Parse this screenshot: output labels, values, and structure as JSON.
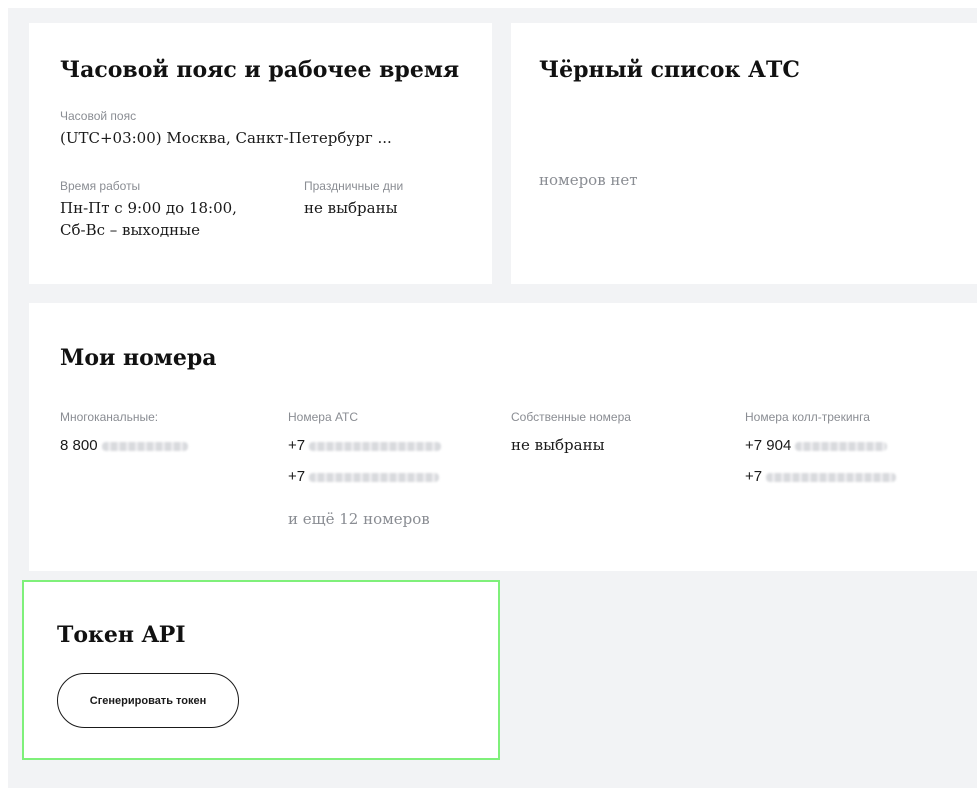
{
  "timezone_card": {
    "title": "Часовой пояс и рабочее время",
    "timezone_label": "Часовой пояс",
    "timezone_value": "(UTC+03:00) Москва, Санкт-Петербург ...",
    "work_label": "Время работы",
    "work_value_line1": "Пн-Пт с 9:00 до 18:00,",
    "work_value_line2": "Сб-Вс – выходные",
    "holidays_label": "Праздничные дни",
    "holidays_value": "не выбраны"
  },
  "blacklist_card": {
    "title": "Чёрный список АТС",
    "empty_text": "номеров нет"
  },
  "numbers_card": {
    "title": "Мои номера",
    "columns": {
      "multichannel": {
        "label": "Многоканальные:",
        "items": [
          "8 800"
        ]
      },
      "ats": {
        "label": "Номера АТС",
        "items": [
          "+7",
          "+7"
        ],
        "more": "и ещё 12 номеров"
      },
      "own": {
        "label": "Собственные номера",
        "value": "не выбраны"
      },
      "tracking": {
        "label": "Номера колл-трекинга",
        "items": [
          "+7 904",
          "+7"
        ]
      }
    }
  },
  "token_card": {
    "title": "Токен API",
    "button_label": "Сгенерировать токен",
    "highlight_color": "#7ff07a"
  }
}
